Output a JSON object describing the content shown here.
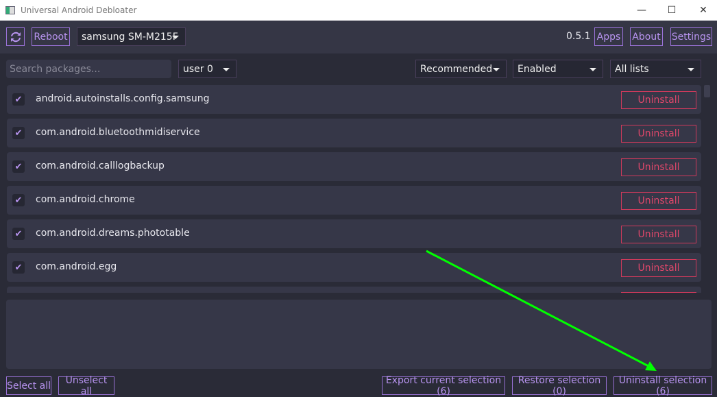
{
  "window": {
    "title": "Universal Android Debloater",
    "minimize": "—",
    "maximize": "☐",
    "close": "✕"
  },
  "topbar": {
    "reboot": "Reboot",
    "device": "samsung SM-M215F",
    "version": "0.5.1",
    "apps": "Apps",
    "about": "About",
    "settings": "Settings"
  },
  "filters": {
    "search_placeholder": "Search packages...",
    "user": "user 0",
    "removal": "Recommended",
    "state": "Enabled",
    "list": "All lists"
  },
  "packages": [
    {
      "name": "android.autoinstalls.config.samsung",
      "action": "Uninstall"
    },
    {
      "name": "com.android.bluetoothmidiservice",
      "action": "Uninstall"
    },
    {
      "name": "com.android.calllogbackup",
      "action": "Uninstall"
    },
    {
      "name": "com.android.chrome",
      "action": "Uninstall"
    },
    {
      "name": "com.android.dreams.phototable",
      "action": "Uninstall"
    },
    {
      "name": "com.android.egg",
      "action": "Uninstall"
    }
  ],
  "footer": {
    "select_all": "Select all",
    "unselect_all": "Unselect all",
    "export": "Export current selection (6)",
    "restore": "Restore selection (0)",
    "uninstall": "Uninstall selection (6)"
  },
  "colors": {
    "accent": "#b894f0",
    "danger": "#e0476a",
    "annotation": "#00ff00"
  }
}
